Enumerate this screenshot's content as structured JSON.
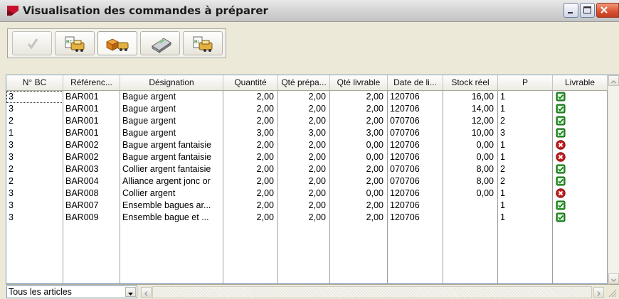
{
  "window": {
    "title": "Visualisation des commandes à préparer",
    "brand_color": "#c8102e"
  },
  "toolbar": {
    "buttons": [
      {
        "icon": "checkmark-icon",
        "state": "disabled"
      },
      {
        "icon": "bc-print-icon",
        "badge": "BC",
        "state": "normal"
      },
      {
        "icon": "boxes-icon",
        "state": "pressed"
      },
      {
        "icon": "calculator-icon",
        "state": "normal"
      },
      {
        "icon": "bl-print-icon",
        "badge": "BL",
        "state": "normal"
      }
    ]
  },
  "table": {
    "columns": [
      "N° BC",
      "Référenc...",
      "Désignation",
      "Quantité",
      "Qté prépa...",
      "Qté livrable",
      "Date de li...",
      "Stock réel",
      "P",
      "Livrable"
    ],
    "rows": [
      {
        "bc": "3",
        "ref": "BAR001",
        "designation": "Bague argent",
        "quantite": "2,00",
        "qte_prep": "2,00",
        "qte_livrable": "2,00",
        "date": "120706",
        "stock": "16,00",
        "p": "1",
        "livrable": "ok"
      },
      {
        "bc": "3",
        "ref": "BAR001",
        "designation": "Bague argent",
        "quantite": "2,00",
        "qte_prep": "2,00",
        "qte_livrable": "2,00",
        "date": "120706",
        "stock": "14,00",
        "p": "1",
        "livrable": "ok"
      },
      {
        "bc": "2",
        "ref": "BAR001",
        "designation": "Bague argent",
        "quantite": "2,00",
        "qte_prep": "2,00",
        "qte_livrable": "2,00",
        "date": "070706",
        "stock": "12,00",
        "p": "2",
        "livrable": "ok"
      },
      {
        "bc": "1",
        "ref": "BAR001",
        "designation": "Bague argent",
        "quantite": "3,00",
        "qte_prep": "3,00",
        "qte_livrable": "3,00",
        "date": "070706",
        "stock": "10,00",
        "p": "3",
        "livrable": "ok"
      },
      {
        "bc": "3",
        "ref": "BAR002",
        "designation": "Bague argent fantaisie",
        "quantite": "2,00",
        "qte_prep": "2,00",
        "qte_livrable": "0,00",
        "date": "120706",
        "stock": "0,00",
        "p": "1",
        "livrable": "no"
      },
      {
        "bc": "3",
        "ref": "BAR002",
        "designation": "Bague argent fantaisie",
        "quantite": "2,00",
        "qte_prep": "2,00",
        "qte_livrable": "0,00",
        "date": "120706",
        "stock": "0,00",
        "p": "1",
        "livrable": "no"
      },
      {
        "bc": "2",
        "ref": "BAR003",
        "designation": "Collier argent fantaisie",
        "quantite": "2,00",
        "qte_prep": "2,00",
        "qte_livrable": "2,00",
        "date": "070706",
        "stock": "8,00",
        "p": "2",
        "livrable": "ok"
      },
      {
        "bc": "2",
        "ref": "BAR004",
        "designation": "Alliance argent jonc or",
        "quantite": "2,00",
        "qte_prep": "2,00",
        "qte_livrable": "2,00",
        "date": "070706",
        "stock": "8,00",
        "p": "2",
        "livrable": "ok"
      },
      {
        "bc": "3",
        "ref": "BAR008",
        "designation": "Collier argent",
        "quantite": "2,00",
        "qte_prep": "2,00",
        "qte_livrable": "0,00",
        "date": "120706",
        "stock": "0,00",
        "p": "1",
        "livrable": "no"
      },
      {
        "bc": "3",
        "ref": "BAR007",
        "designation": "Ensemble bagues ar...",
        "quantite": "2,00",
        "qte_prep": "2,00",
        "qte_livrable": "2,00",
        "date": "120706",
        "stock": "",
        "p": "1",
        "livrable": "ok"
      },
      {
        "bc": "3",
        "ref": "BAR009",
        "designation": "Ensemble bague et ...",
        "quantite": "2,00",
        "qte_prep": "2,00",
        "qte_livrable": "2,00",
        "date": "120706",
        "stock": "",
        "p": "1",
        "livrable": "ok"
      }
    ]
  },
  "filter": {
    "selected": "Tous les articles"
  },
  "colors": {
    "status_ok": "#2e9e2e",
    "status_no": "#c81e1e"
  }
}
